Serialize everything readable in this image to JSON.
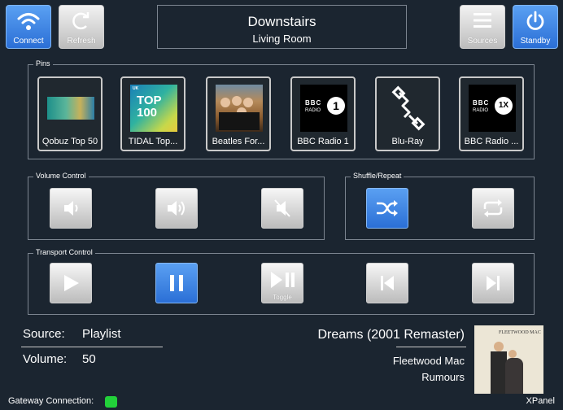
{
  "top_bar": {
    "connect_label": "Connect",
    "refresh_label": "Refresh",
    "sources_label": "Sources",
    "standby_label": "Standby",
    "zone": "Downstairs",
    "room": "Living Room"
  },
  "pins": {
    "title": "Pins",
    "items": [
      {
        "label": "Qobuz Top 50",
        "icon": "qobuz-art"
      },
      {
        "label": "TIDAL Top...",
        "icon": "tidal-top100-art",
        "art_text": "TOP 100",
        "art_tag": "UK"
      },
      {
        "label": "Beatles For...",
        "icon": "beatles-for-sale-art"
      },
      {
        "label": "BBC Radio 1",
        "icon": "bbc-radio1-logo",
        "art_text_bbc": "BBC",
        "art_text_radio": "RADIO",
        "art_num": "1"
      },
      {
        "label": "Blu-Ray",
        "icon": "cable-icon"
      },
      {
        "label": "BBC Radio ...",
        "icon": "bbc-radio1x-logo",
        "art_text_bbc": "BBC",
        "art_text_radio": "RADIO",
        "art_num": "1X"
      }
    ]
  },
  "volume": {
    "title": "Volume Control",
    "buttons": [
      "volume-down-icon",
      "volume-up-icon",
      "mute-icon"
    ]
  },
  "shuffle_repeat": {
    "title": "Shuffle/Repeat",
    "buttons": [
      "shuffle-icon",
      "repeat-icon"
    ]
  },
  "transport": {
    "title": "Transport Control",
    "toggle_label": "Toggle",
    "buttons": [
      "play-icon",
      "pause-icon",
      "play-pause-icon",
      "previous-icon",
      "next-icon"
    ]
  },
  "status": {
    "source_label": "Source:",
    "source_value": "Playlist",
    "volume_label": "Volume:",
    "volume_value": "50"
  },
  "now_playing": {
    "track": "Dreams (2001 Remaster)",
    "artist": "Fleetwood Mac",
    "album": "Rumours",
    "art_text": "FLEETWOOD MAC"
  },
  "footer": {
    "gateway_label": "Gateway Connection:",
    "gateway_color": "#22d13a",
    "panel_label": "XPanel"
  },
  "colors": {
    "background": "#1b2530",
    "accent": "#2b6fd6",
    "border": "#7c8590"
  }
}
